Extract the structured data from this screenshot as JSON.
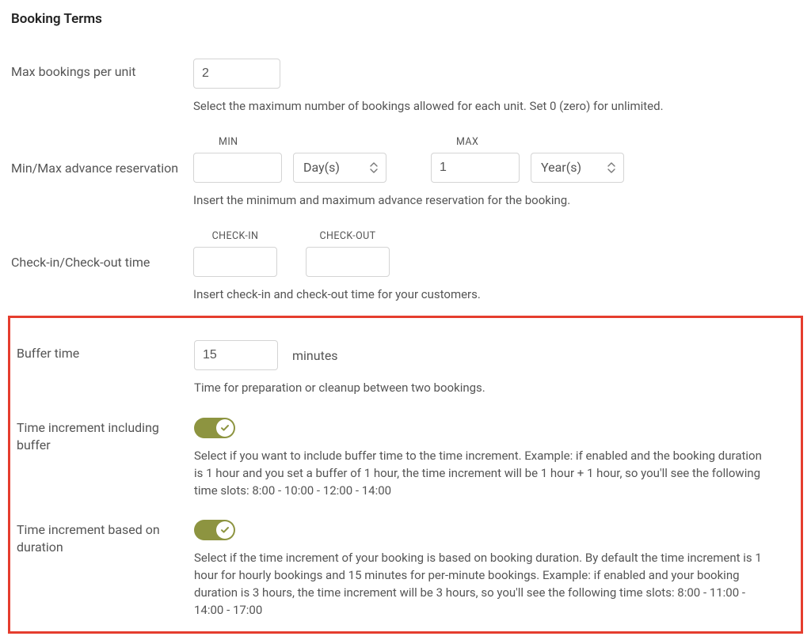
{
  "section_title": "Booking Terms",
  "fields": {
    "max_bookings": {
      "label": "Max bookings per unit",
      "value": "2",
      "description": "Select the maximum number of bookings allowed for each unit. Set 0 (zero) for unlimited."
    },
    "advance_reservation": {
      "label": "Min/Max advance reservation",
      "min_header": "MIN",
      "max_header": "MAX",
      "min_value": "",
      "min_unit": "Day(s)",
      "max_value": "1",
      "max_unit": "Year(s)",
      "description": "Insert the minimum and maximum advance reservation for the booking."
    },
    "check_times": {
      "label": "Check-in/Check-out time",
      "checkin_header": "CHECK-IN",
      "checkout_header": "CHECK-OUT",
      "checkin_value": "",
      "checkout_value": "",
      "description": "Insert check-in and check-out time for your customers."
    },
    "buffer": {
      "label": "Buffer time",
      "value": "15",
      "unit": "minutes",
      "description": "Time for preparation or cleanup between two bookings."
    },
    "increment_buffer": {
      "label": "Time increment including buffer",
      "enabled": true,
      "description": "Select if you want to include buffer time to the time increment. Example: if enabled and the booking duration is 1 hour and you set a buffer of 1 hour, the time increment will be 1 hour + 1 hour, so you'll see the following time slots: 8:00 - 10:00 - 12:00 - 14:00"
    },
    "increment_duration": {
      "label": "Time increment based on duration",
      "enabled": true,
      "description": "Select if the time increment of your booking is based on booking duration. By default the time increment is 1 hour for hourly bookings and 15 minutes for per-minute bookings. Example: if enabled and your booking duration is 3 hours, the time increment will be 3 hours, so you'll see the following time slots: 8:00 - 11:00 - 14:00 - 17:00"
    }
  },
  "colors": {
    "toggle_on": "#8d9440",
    "highlight_border": "#e53d2e"
  }
}
